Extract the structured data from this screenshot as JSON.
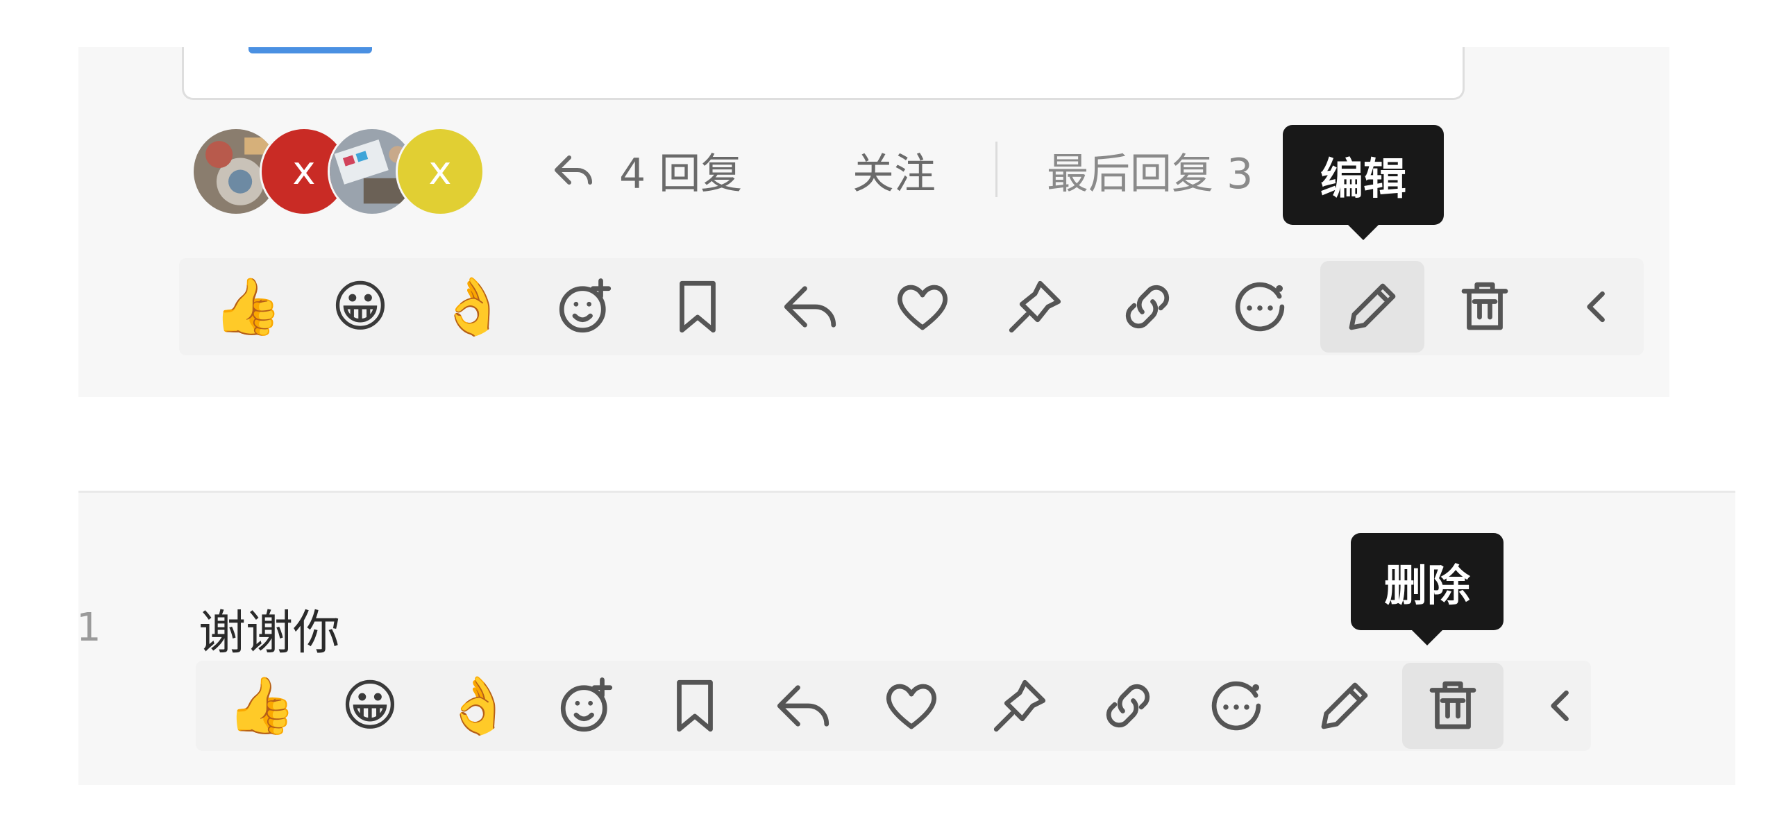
{
  "thread": {
    "avatars": [
      {
        "name": "photo-avatar-1",
        "type": "photo"
      },
      {
        "name": "letter-avatar-red",
        "letter": "x",
        "color": "#c92b25"
      },
      {
        "name": "photo-avatar-2",
        "type": "photo"
      },
      {
        "name": "letter-avatar-yellow",
        "letter": "x",
        "color": "#e1cf33"
      }
    ],
    "reply_count_label": "4 回复",
    "follow_label": "关注",
    "last_reply_label": "最后回复 3",
    "edit_tooltip": "编辑"
  },
  "message": {
    "line_number": "1",
    "text": "谢谢你",
    "delete_tooltip": "删除"
  },
  "toolbar": {
    "items": [
      {
        "name": "thumbs-up-reaction",
        "icon": "thumbs-up-emoji",
        "glyph": "👍"
      },
      {
        "name": "grinning-reaction",
        "icon": "grinning-face-emoji",
        "glyph": "😀"
      },
      {
        "name": "ok-hand-reaction",
        "icon": "ok-hand-emoji",
        "glyph": "👌"
      },
      {
        "name": "add-reaction-button",
        "icon": "emoji-plus-icon"
      },
      {
        "name": "bookmark-button",
        "icon": "bookmark-icon"
      },
      {
        "name": "reply-button",
        "icon": "reply-icon"
      },
      {
        "name": "like-button",
        "icon": "heart-icon"
      },
      {
        "name": "pin-button",
        "icon": "pin-icon"
      },
      {
        "name": "copy-link-button",
        "icon": "link-icon"
      },
      {
        "name": "more-actions-button",
        "icon": "more-icon"
      },
      {
        "name": "edit-button",
        "icon": "pencil-icon"
      },
      {
        "name": "delete-button",
        "icon": "trash-icon"
      },
      {
        "name": "collapse-button",
        "icon": "chevron-left-icon"
      }
    ],
    "active_top": "edit-button",
    "active_bottom": "delete-button"
  },
  "colors": {
    "panel_bg": "#f7f7f7",
    "tooltip_bg": "#181818",
    "icon": "#555555",
    "accent": "#4a90e2"
  }
}
